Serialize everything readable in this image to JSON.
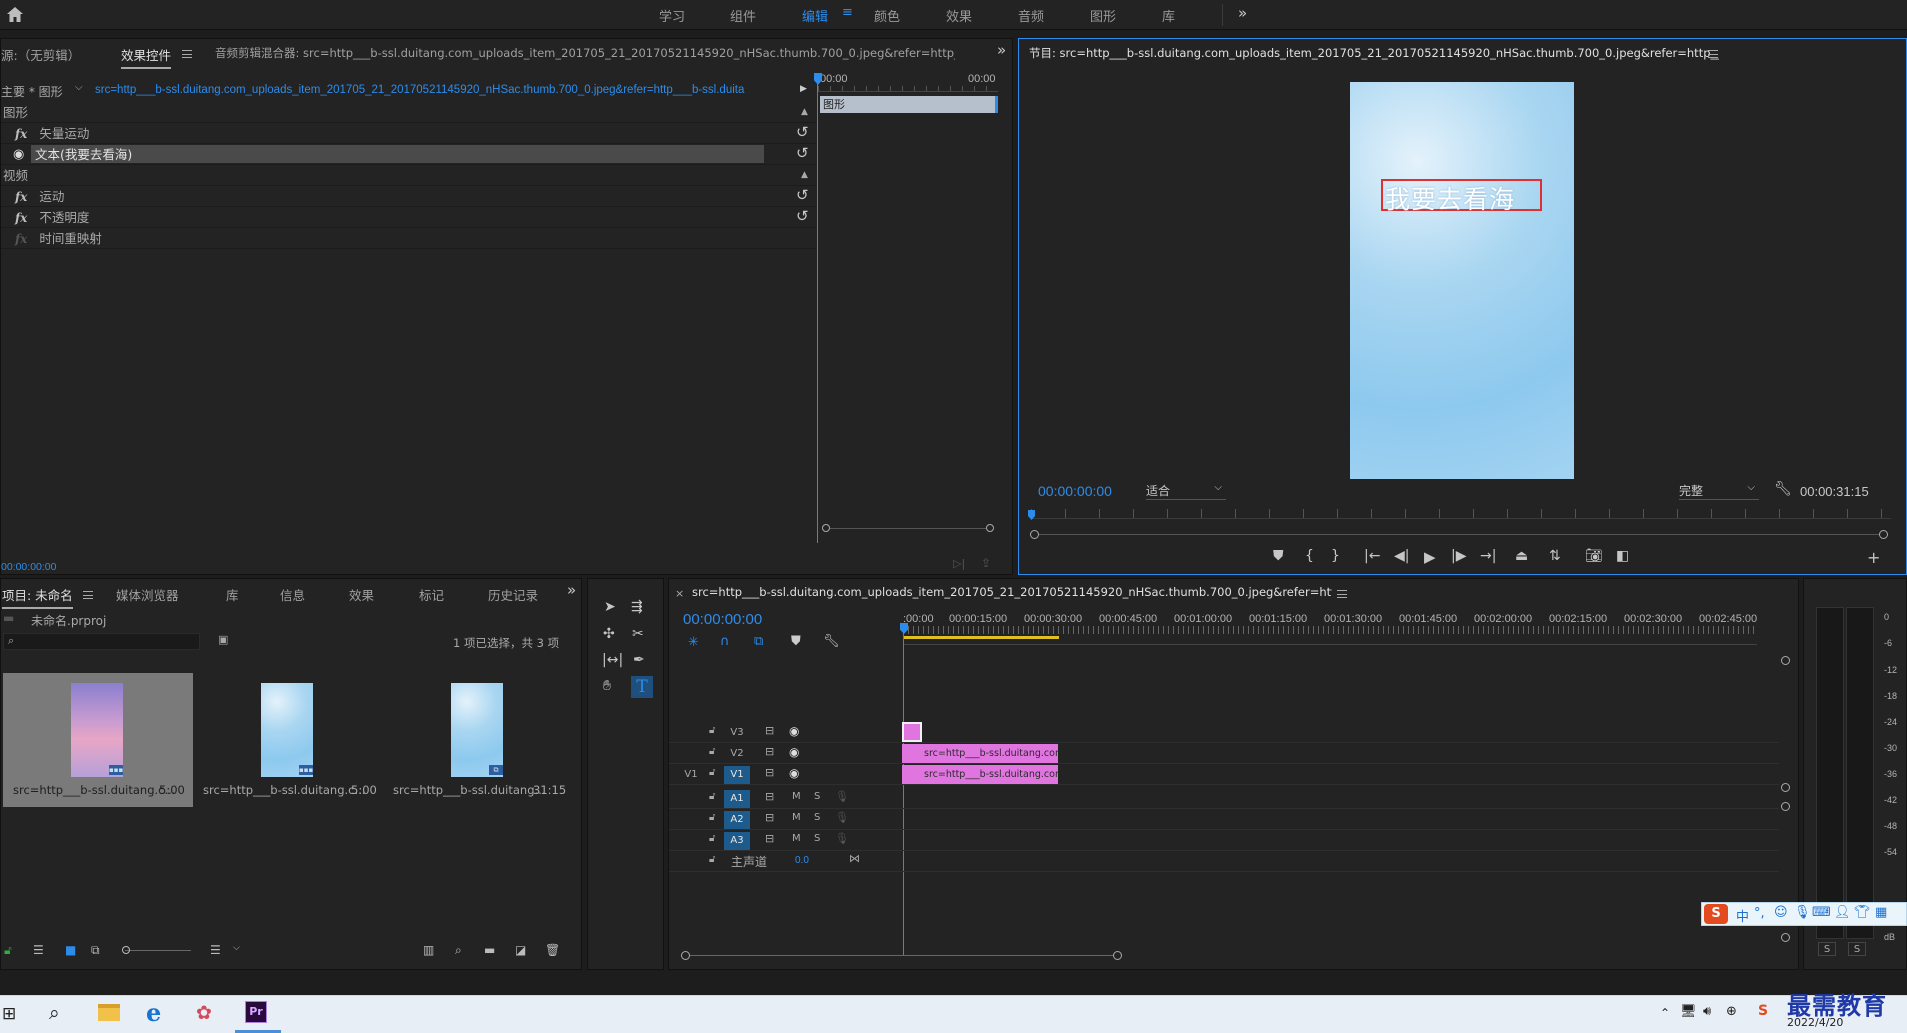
{
  "workspaces": {
    "items": [
      "学习",
      "组件",
      "编辑",
      "颜色",
      "效果",
      "音频",
      "图形",
      "库"
    ],
    "active": "编辑"
  },
  "source_panel": {
    "tab_source": "源:（无剪辑）",
    "tab_effect_controls": "效果控件",
    "tab_audio_mixer": "音频剪辑混合器: src=http___b-ssl.duitang.com_uploads_item_201705_21_20170521145920_nHSac.thumb.700_0.jpeg&refer=http___b-ssl.duitang",
    "master_label": "主要 * 图形",
    "clip_path": "src=http___b-ssl.duitang.com_uploads_item_201705_21_20170521145920_nHSac.thumb.700_0.jpeg&refer=http___b-ssl.duitang * ...",
    "timecode_start": "00:00",
    "timecode_end": "00:00",
    "mini_clip_label": "图形",
    "section_graphics": "图形",
    "row_vector_motion": "矢量运动",
    "row_text": "文本(我要去看海)",
    "section_video": "视频",
    "row_motion": "运动",
    "row_opacity": "不透明度",
    "row_time_remap": "时间重映射",
    "footer_timecode": "00:00:00:00"
  },
  "program_monitor": {
    "title": "节目: src=http___b-ssl.duitang.com_uploads_item_201705_21_20170521145920_nHSac.thumb.700_0.jpeg&refer=http___b-ssl.duitang",
    "overlay_text": "我要去看海",
    "timecode": "00:00:00:00",
    "fit_select": "适合",
    "quality_select": "完整",
    "duration": "00:00:31:15"
  },
  "project_panel": {
    "tabs": [
      "项目: 未命名",
      "媒体浏览器",
      "库",
      "信息",
      "效果",
      "标记",
      "历史记录"
    ],
    "project_file": "未命名.prproj",
    "selection_info": "1 项已选择，共 3 项",
    "search_placeholder": "",
    "items": [
      {
        "name": "src=http___b-ssl.duitang.c...",
        "duration": "5:00"
      },
      {
        "name": "src=http___b-ssl.duitang.c...",
        "duration": "5:00"
      },
      {
        "name": "src=http___b-ssl.duitang...",
        "duration": "31:15"
      }
    ]
  },
  "timeline": {
    "title": "src=http___b-ssl.duitang.com_uploads_item_201705_21_20170521145920_nHSac.thumb.700_0.jpeg&refer=http___b-ssl.duitang",
    "timecode": "00:00:00:00",
    "ruler": [
      ":00:00",
      "00:00:15:00",
      "00:00:30:00",
      "00:00:45:00",
      "00:01:00:00",
      "00:01:15:00",
      "00:01:30:00",
      "00:01:45:00",
      "00:02:00:00",
      "00:02:15:00",
      "00:02:30:00",
      "00:02:45:00"
    ],
    "video_tracks": [
      "V3",
      "V2",
      "V1"
    ],
    "source_patch": "V1",
    "audio_tracks": [
      "A1",
      "A2",
      "A3"
    ],
    "mute_label": "M",
    "solo_label": "S",
    "master_label": "主声道",
    "master_value": "0.0",
    "clip_v2": "src=http___b-ssl.duitang.com_",
    "clip_v1": "src=http___b-ssl.duitang.com_"
  },
  "audio_meter": {
    "scale": [
      "0",
      "-6",
      "-12",
      "-18",
      "-24",
      "-30",
      "-36",
      "-42",
      "-48",
      "-54",
      "dB"
    ],
    "solo_buttons": [
      "S",
      "S"
    ]
  },
  "ime_toolbar": {
    "labels": [
      "中",
      "°,"
    ]
  },
  "taskbar": {
    "date": "2022/4/20",
    "watermark": "最需教育"
  },
  "colors": {
    "accent_blue": "#2d8ceb",
    "clip_pink": "#e175e0",
    "panel_bg": "#232323",
    "playhead": "#2d8ceb",
    "selection_red": "#e03030"
  }
}
